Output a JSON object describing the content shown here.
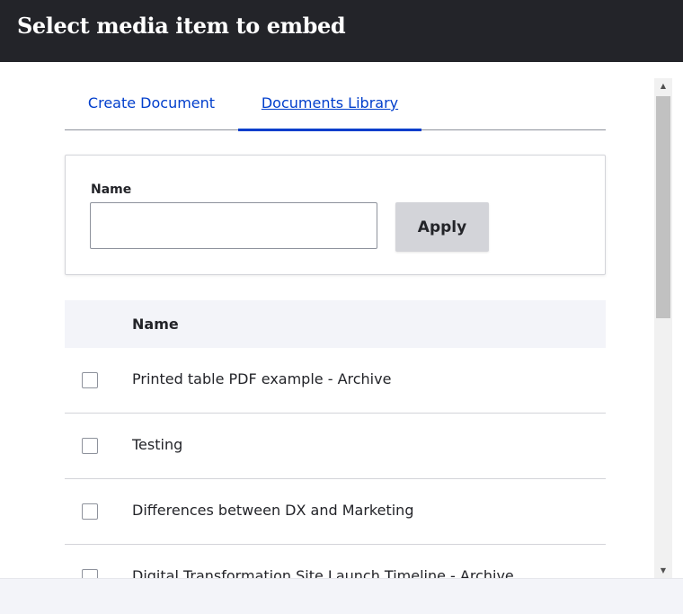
{
  "dialog": {
    "title": "Select media item to embed"
  },
  "tabs": [
    {
      "label": "Create Document",
      "active": false
    },
    {
      "label": "Documents Library",
      "active": true
    }
  ],
  "filter": {
    "name_label": "Name",
    "name_value": "",
    "name_placeholder": "",
    "apply_label": "Apply"
  },
  "table": {
    "header_name": "Name",
    "rows": [
      {
        "name": "Printed table PDF example - Archive",
        "checked": false
      },
      {
        "name": "Testing",
        "checked": false
      },
      {
        "name": "Differences between DX and Marketing",
        "checked": false
      },
      {
        "name": "Digital Transformation Site Launch Timeline - Archive",
        "checked": false
      }
    ]
  },
  "colors": {
    "header_bg": "#232429",
    "link": "#003ecc",
    "table_header_bg": "#f3f4f9",
    "button_bg": "#d3d4d9"
  }
}
